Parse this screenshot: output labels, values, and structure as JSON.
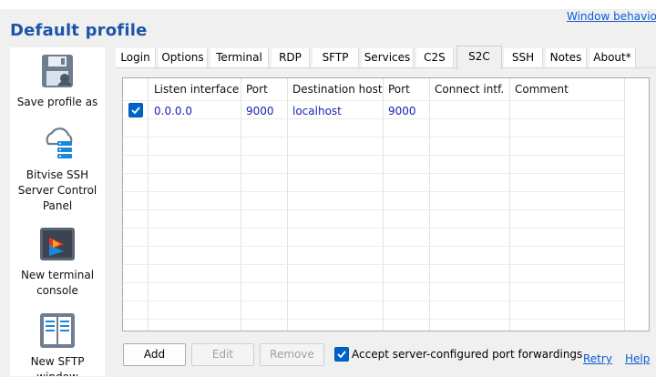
{
  "header": {
    "window_behavior_link": "Window behavior",
    "title": "Default profile"
  },
  "sidebar": {
    "items": [
      {
        "label": "Save profile as",
        "icon": "save-profile-icon"
      },
      {
        "label": "Bitvise SSH Server Control Panel",
        "label_lines": [
          "Bitvise SSH",
          "Server Control",
          "Panel"
        ],
        "icon": "server-control-panel-icon"
      },
      {
        "label": "New terminal console",
        "label_lines": [
          "New terminal",
          "console"
        ],
        "icon": "terminal-console-icon"
      },
      {
        "label": "New SFTP window",
        "label_lines": [
          "New SFTP",
          "window"
        ],
        "icon": "sftp-window-icon"
      }
    ]
  },
  "tabs": [
    {
      "label": "Login"
    },
    {
      "label": "Options"
    },
    {
      "label": "Terminal"
    },
    {
      "label": "RDP"
    },
    {
      "label": "SFTP"
    },
    {
      "label": "Services"
    },
    {
      "label": "C2S"
    },
    {
      "label": "S2C",
      "active": true
    },
    {
      "label": "SSH"
    },
    {
      "label": "Notes"
    },
    {
      "label": "About*"
    }
  ],
  "table": {
    "columns": [
      "Listen interface",
      "Port",
      "Destination host",
      "Port",
      "Connect intf.",
      "Comment"
    ],
    "rows": [
      {
        "checked": true,
        "cells": [
          "0.0.0.0",
          "9000",
          "localhost",
          "9000",
          "",
          ""
        ]
      }
    ]
  },
  "buttons": {
    "add": "Add",
    "edit": "Edit",
    "remove": "Remove"
  },
  "accept_forwardings": {
    "label": "Accept server-configured port forwardings",
    "checked": true
  },
  "links": {
    "retry": "Retry",
    "help": "Help"
  },
  "colors": {
    "title": "#1c55a8",
    "link": "#0b5cd5",
    "data_text": "#1a23b5",
    "checkbox": "#0063c8"
  }
}
